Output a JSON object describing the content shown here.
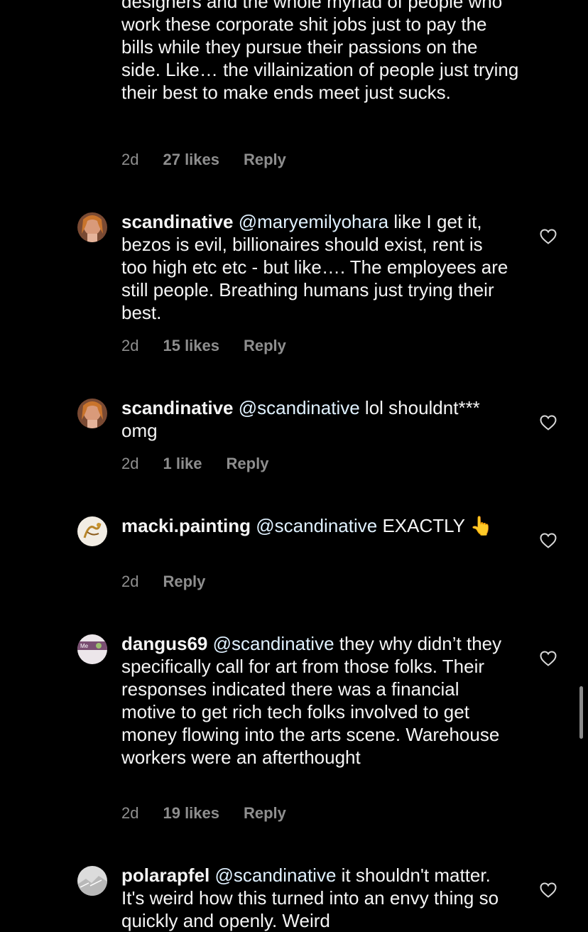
{
  "fragment": {
    "text": "designers and the whole myriad of people who work these corporate shit jobs just to pay the bills while they pursue their passions on the side. Like… the villainization of people just trying their best to make ends meet just sucks.",
    "time": "2d",
    "likes": "27 likes",
    "reply": "Reply"
  },
  "comments": [
    {
      "username": "scandinative",
      "mention": "@maryemilyohara",
      "text": " like I get it, bezos is evil, billionaires should exist, rent is too high etc etc - but like…. The employees are still people. Breathing humans just trying their best.",
      "time": "2d",
      "likes": "15 likes",
      "reply": "Reply"
    },
    {
      "username": "scandinative",
      "mention": "@scandinative",
      "text": " lol shouldnt*** omg",
      "time": "2d",
      "likes": "1 like",
      "reply": "Reply"
    },
    {
      "username": "macki.painting",
      "mention": "@scandinative",
      "text": " EXACTLY 👆",
      "time": "2d",
      "likes": "",
      "reply": "Reply"
    },
    {
      "username": "dangus69",
      "mention": "@scandinative",
      "text": " they why didn’t they specifically call for art from those folks. Their responses indicated there was a financial motive to get rich tech folks involved to get money flowing into the arts scene. Warehouse workers were an afterthought",
      "time": "2d",
      "likes": "19 likes",
      "reply": "Reply"
    },
    {
      "username": "polarapfel",
      "mention": "@scandinative",
      "text": " it shouldn't matter. It's weird how this turned into an envy thing so quickly and openly. Weird",
      "time": "",
      "likes": "",
      "reply": ""
    }
  ],
  "icons": {
    "like": "heart-outline-icon",
    "avatar_label_dangus": "Me"
  },
  "colors": {
    "background": "#000000",
    "text": "#f5f5f5",
    "secondary": "#8e8e8e",
    "mention": "#e0f1ff"
  }
}
